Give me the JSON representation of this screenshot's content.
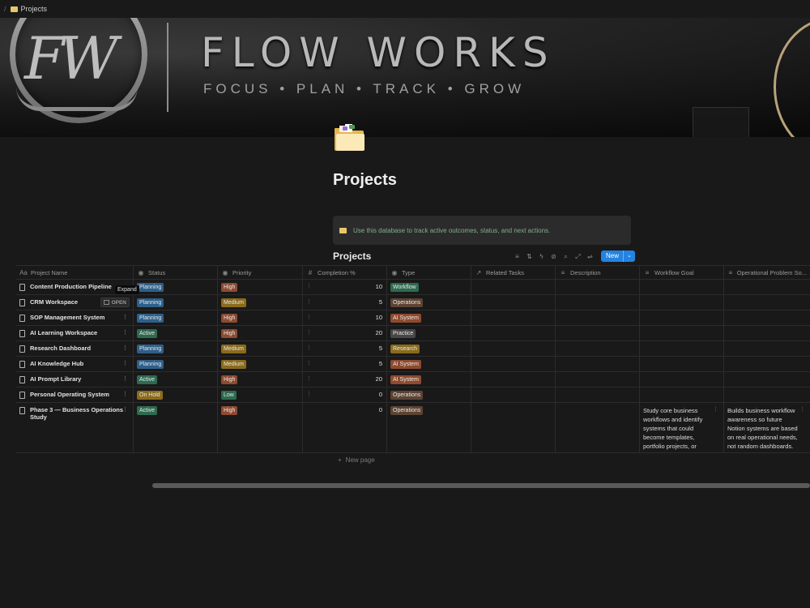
{
  "breadcrumb": {
    "separator": "/",
    "page": "Projects",
    "page_icon": "folder-icon"
  },
  "banner": {
    "logo_text": "FW",
    "brand": "FLOW WORKS",
    "tagline": "FOCUS • PLAN • TRACK • GROW"
  },
  "page": {
    "title": "Projects",
    "icon": "open-folder-icon"
  },
  "callout": {
    "text": "Use this database to track active outcomes, status, and next actions.",
    "icon": "folder-icon"
  },
  "database": {
    "title": "Projects",
    "new_label": "New",
    "toolbar_icons": [
      "filter-icon",
      "sort-icon",
      "lightning-icon",
      "automation-icon",
      "search-icon",
      "expand-icon",
      "settings-icon"
    ]
  },
  "columns": [
    {
      "label": "Project Name",
      "icon": "Aa"
    },
    {
      "label": "Status",
      "icon": "◉"
    },
    {
      "label": "Priority",
      "icon": "◉"
    },
    {
      "label": "Completion %",
      "icon": "#"
    },
    {
      "label": "Type",
      "icon": "◉"
    },
    {
      "label": "Related Tasks",
      "icon": "↗"
    },
    {
      "label": "Description",
      "icon": "≡"
    },
    {
      "label": "Workflow Goal",
      "icon": "≡"
    },
    {
      "label": "Operational Problem So...",
      "icon": "≡"
    }
  ],
  "hover": {
    "tooltip": "Expand",
    "open_label": "OPEN"
  },
  "rows": [
    {
      "name": "Content Production Pipeline",
      "status": "Planning",
      "priority": "High",
      "completion": "10",
      "type": "Workflow",
      "workflow_goal": "",
      "operational_problem": ""
    },
    {
      "name": "CRM Workspace",
      "status": "Planning",
      "priority": "Medium",
      "completion": "5",
      "type": "Operations",
      "workflow_goal": "",
      "operational_problem": ""
    },
    {
      "name": "SOP Management System",
      "status": "Planning",
      "priority": "High",
      "completion": "10",
      "type": "AI System",
      "workflow_goal": "",
      "operational_problem": ""
    },
    {
      "name": "AI Learning Workspace",
      "status": "Active",
      "priority": "High",
      "completion": "20",
      "type": "Practice",
      "workflow_goal": "",
      "operational_problem": ""
    },
    {
      "name": "Research Dashboard",
      "status": "Planning",
      "priority": "Medium",
      "completion": "5",
      "type": "Research",
      "workflow_goal": "",
      "operational_problem": ""
    },
    {
      "name": "AI Knowledge Hub",
      "status": "Planning",
      "priority": "Medium",
      "completion": "5",
      "type": "AI System",
      "workflow_goal": "",
      "operational_problem": ""
    },
    {
      "name": "AI Prompt Library",
      "status": "Active",
      "priority": "High",
      "completion": "20",
      "type": "AI System",
      "workflow_goal": "",
      "operational_problem": ""
    },
    {
      "name": "Personal Operating System",
      "status": "On Hold",
      "priority": "Low",
      "completion": "0",
      "type": "Operations",
      "workflow_goal": "",
      "operational_problem": ""
    },
    {
      "name": "Phase 3 — Business Operations Study",
      "status": "Active",
      "priority": "High",
      "completion": "0",
      "type": "Operations",
      "workflow_goal": "Study core business workflows and identify systems that could become templates, portfolio projects, or beginner services.",
      "operational_problem": "Builds business workflow awareness so future Notion systems are based on real operational needs, not random dashboards."
    }
  ],
  "new_page_label": "New page",
  "colors": {
    "status": {
      "Planning": "#2e5f8a",
      "Active": "#2d6a4f",
      "On Hold": "#8a6a1c"
    },
    "priority": {
      "High": "#8e4a2f",
      "Medium": "#8a6a1c",
      "Low": "#2d6a4f"
    },
    "type": {
      "Workflow": "#2d6a4f",
      "Operations": "#5c4332",
      "AI System": "#8e4a2f",
      "Practice": "#474747",
      "Research": "#8a6a1c"
    },
    "accent": "#2383e2"
  }
}
